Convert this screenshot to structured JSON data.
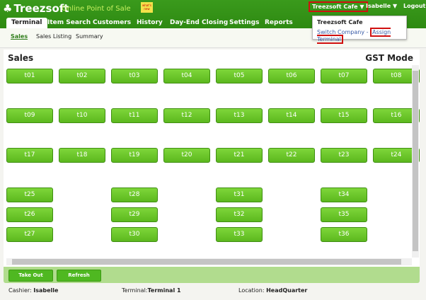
{
  "header": {
    "logo": "Treezsoft",
    "tagline": "Online Point of Sale",
    "note": "what's new",
    "company": "Treezsoft Cafe ▼",
    "user": "Isabelle ▼",
    "logout": "Logout"
  },
  "tabs": [
    "Terminal",
    "Item Search",
    "Customers",
    "History",
    "Day-End Closing",
    "Settings",
    "Reports"
  ],
  "dropdown": {
    "title": "Treezsoft Cafe",
    "switch": "Switch Company",
    "sep": " - ",
    "assign": "Assign Terminal"
  },
  "subnav": [
    "Sales",
    "Sales Listing",
    "Summary"
  ],
  "main": {
    "title": "Sales",
    "mode": "GST Mode"
  },
  "tables": [
    [
      "t01",
      "t02",
      "t03",
      "t04",
      "t05",
      "t06",
      "t07",
      "t08"
    ],
    [
      "t09",
      "t10",
      "t11",
      "t12",
      "t13",
      "t14",
      "t15",
      "t16"
    ],
    [
      "t17",
      "t18",
      "t19",
      "t20",
      "t21",
      "t22",
      "t23",
      "t24"
    ],
    [
      "t25",
      null,
      "t28",
      null,
      "t31",
      null,
      "t34",
      null
    ],
    [
      "t26",
      null,
      "t29",
      null,
      "t32",
      null,
      "t35",
      null
    ],
    [
      "t27",
      null,
      "t30",
      null,
      "t33",
      null,
      "t36",
      null
    ]
  ],
  "buttons": {
    "takeout": "Take Out",
    "refresh": "Refresh"
  },
  "footer": {
    "cashier_label": "Cashier: ",
    "cashier": "Isabelle",
    "terminal_label": "Terminal:",
    "terminal": "Terminal 1",
    "location_label": "Location: ",
    "location": "HeadQuarter"
  }
}
